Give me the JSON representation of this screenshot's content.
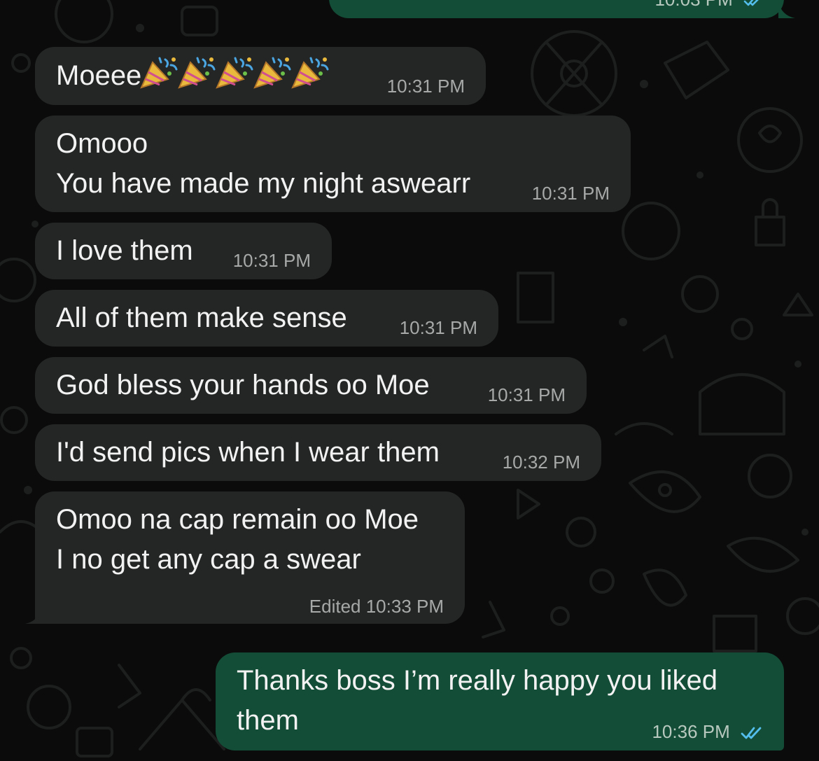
{
  "top_partial": {
    "time": "10:03 PM",
    "status": "read-double-check-icon"
  },
  "messages": [
    {
      "direction": "in",
      "lines": [
        "Moeee"
      ],
      "emoji": "party-popper-icon",
      "emoji_count": 5,
      "time": "10:31 PM"
    },
    {
      "direction": "in",
      "lines": [
        "Omooo",
        "You have made my night aswearr"
      ],
      "time": "10:31 PM"
    },
    {
      "direction": "in",
      "lines": [
        "I love them"
      ],
      "time": "10:31 PM"
    },
    {
      "direction": "in",
      "lines": [
        "All of them make sense"
      ],
      "time": "10:31 PM"
    },
    {
      "direction": "in",
      "lines": [
        "God bless your hands oo Moe"
      ],
      "time": "10:31 PM"
    },
    {
      "direction": "in",
      "lines": [
        "I'd send pics when I wear them"
      ],
      "time": "10:32 PM"
    },
    {
      "direction": "in",
      "lines": [
        "Omoo na cap remain oo Moe",
        "I no get any cap a swear"
      ],
      "time": "Edited 10:33 PM"
    },
    {
      "direction": "out",
      "lines": [
        "Thanks boss I’m really happy you liked",
        "them"
      ],
      "time": "10:36 PM",
      "status": "read-double-check-icon"
    }
  ],
  "colors": {
    "background": "#0b0b0b",
    "incoming_bubble": "#242626",
    "outgoing_bubble": "#144d37",
    "text": "#f2f2f2",
    "timestamp": "#a7a9a9",
    "read_tick": "#53bdeb"
  }
}
